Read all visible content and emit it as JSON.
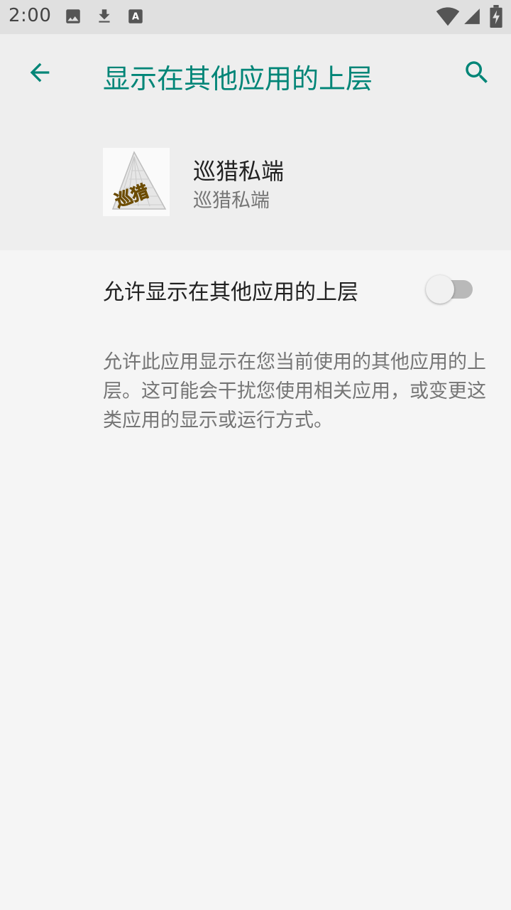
{
  "status_bar": {
    "time": "2:00",
    "notification_icons": [
      "image-icon",
      "download-icon",
      "text-a-icon"
    ],
    "system_icons": [
      "wifi-icon",
      "cellular-signal-icon",
      "battery-charging-icon"
    ]
  },
  "app_bar": {
    "title": "显示在其他应用的上层",
    "back_icon": "arrow-back-icon",
    "search_icon": "search-icon",
    "accent_color": "#008577"
  },
  "app_info": {
    "name": "巡猎私端",
    "subtitle": "巡猎私端",
    "icon_text": "巡猎"
  },
  "permission": {
    "label": "允许显示在其他应用的上层",
    "enabled": false,
    "description": "允许此应用显示在您当前使用的其他应用的上层。这可能会干扰您使用相关应用，或变更这类应用的显示或运行方式。"
  }
}
